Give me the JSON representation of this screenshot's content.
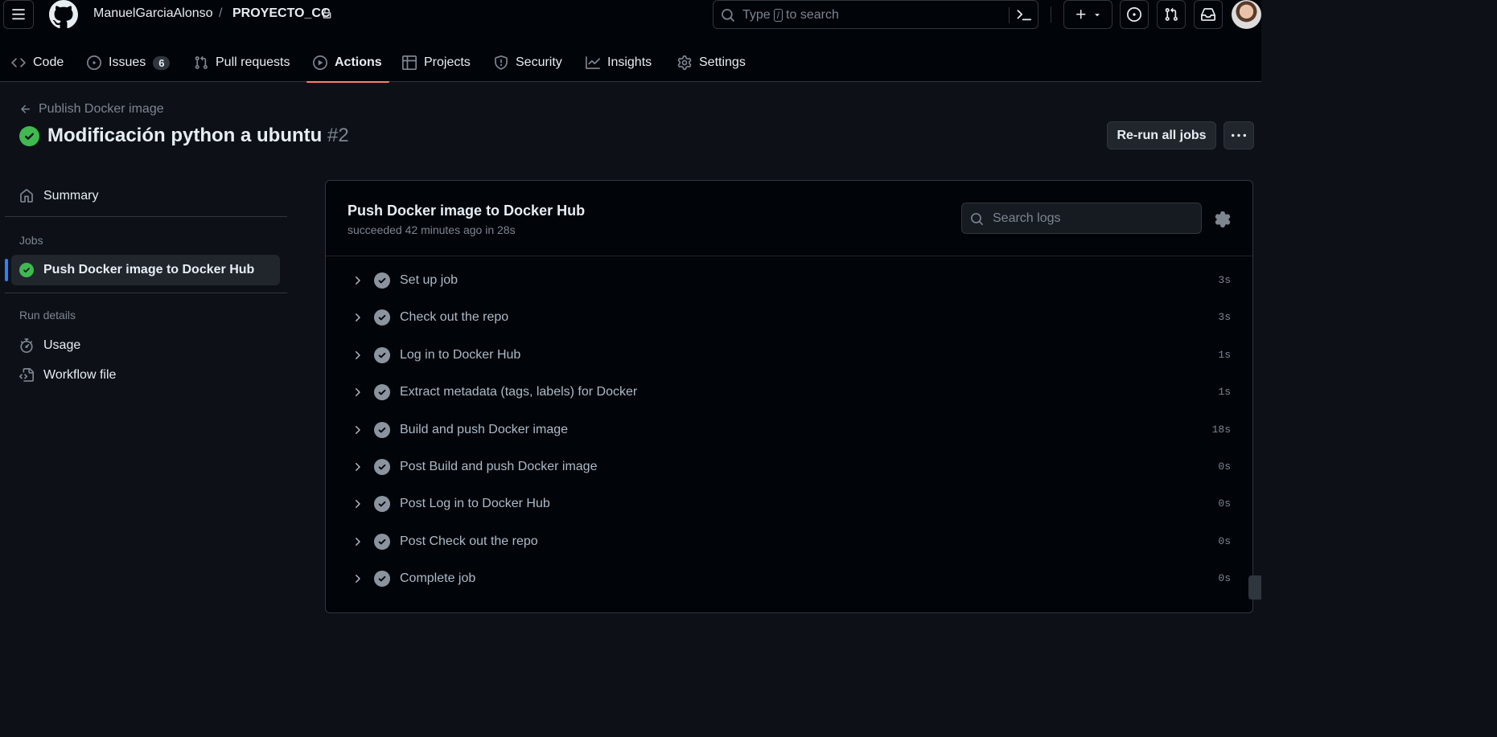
{
  "header": {
    "owner": "ManuelGarciaAlonso",
    "separator": "/",
    "repo": "PROYECTO_CC",
    "search_prefix": "Type",
    "search_key": "/",
    "search_suffix": "to search"
  },
  "tabs": [
    {
      "label": "Code",
      "icon": "code-icon"
    },
    {
      "label": "Issues",
      "icon": "issue-icon",
      "counter": "6"
    },
    {
      "label": "Pull requests",
      "icon": "pull-request-icon"
    },
    {
      "label": "Actions",
      "icon": "play-icon",
      "active": true
    },
    {
      "label": "Projects",
      "icon": "table-icon"
    },
    {
      "label": "Security",
      "icon": "shield-icon"
    },
    {
      "label": "Insights",
      "icon": "graph-icon"
    },
    {
      "label": "Settings",
      "icon": "gear-icon"
    }
  ],
  "run": {
    "back_label": "Publish Docker image",
    "title": "Modificación python a ubuntu",
    "number": "#2",
    "rerun_label": "Re-run all jobs"
  },
  "sidebar": {
    "summary": "Summary",
    "jobs_heading": "Jobs",
    "job": "Push Docker image to Docker Hub",
    "run_details_heading": "Run details",
    "usage": "Usage",
    "workflow_file": "Workflow file"
  },
  "job": {
    "title": "Push Docker image to Docker Hub",
    "subtitle": "succeeded 42 minutes ago in 28s",
    "search_placeholder": "Search logs",
    "steps": [
      {
        "name": "Set up job",
        "duration": "3s"
      },
      {
        "name": "Check out the repo",
        "duration": "3s"
      },
      {
        "name": "Log in to Docker Hub",
        "duration": "1s"
      },
      {
        "name": "Extract metadata (tags, labels) for Docker",
        "duration": "1s"
      },
      {
        "name": "Build and push Docker image",
        "duration": "18s"
      },
      {
        "name": "Post Build and push Docker image",
        "duration": "0s"
      },
      {
        "name": "Post Log in to Docker Hub",
        "duration": "0s"
      },
      {
        "name": "Post Check out the repo",
        "duration": "0s"
      },
      {
        "name": "Complete job",
        "duration": "0s"
      }
    ]
  },
  "colors": {
    "background": "#0d1117",
    "success": "#3fb950",
    "active_tab_underline": "#f78166",
    "selected_job_bar": "#2f81f7"
  }
}
